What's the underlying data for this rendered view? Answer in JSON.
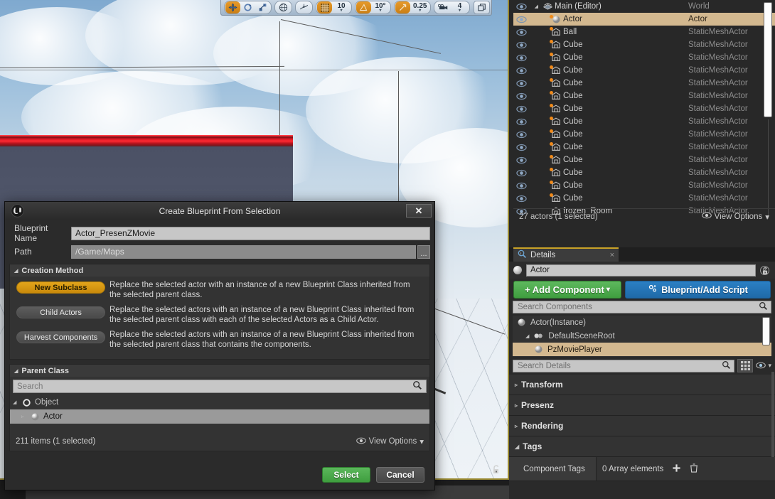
{
  "viewport": {
    "toolbar": {
      "groups": [
        {
          "name": "transform-modes",
          "buttons": [
            {
              "icon": "move-icon",
              "active": true
            },
            {
              "icon": "rotate-icon",
              "active": false
            },
            {
              "icon": "scale-icon",
              "active": false
            }
          ]
        },
        {
          "name": "coordinate-system",
          "buttons": [
            {
              "icon": "globe-icon",
              "active": false
            }
          ]
        },
        {
          "name": "surface-snap",
          "buttons": [
            {
              "icon": "surface-snap-icon",
              "active": false
            }
          ]
        },
        {
          "name": "grid-snap",
          "buttons": [
            {
              "icon": "grid-icon",
              "active": true
            }
          ],
          "value": "10"
        },
        {
          "name": "rotation-snap",
          "buttons": [
            {
              "icon": "angle-icon",
              "active": true
            }
          ],
          "value": "10°"
        },
        {
          "name": "scale-snap",
          "buttons": [
            {
              "icon": "scale-snap-icon",
              "active": true
            }
          ],
          "value": "0.25"
        },
        {
          "name": "camera-speed",
          "buttons": [
            {
              "icon": "camera-icon",
              "active": false
            }
          ],
          "value": "4"
        }
      ],
      "maximize_icon": "maximize-icon"
    },
    "lock_icon": "unlock-icon"
  },
  "outliner": {
    "rows": [
      {
        "name": "Main (Editor)",
        "type": "World",
        "icon": "level-icon",
        "dot": false,
        "selected": false,
        "depth": 0,
        "expander": true
      },
      {
        "name": "Actor",
        "type": "Actor",
        "icon": "sphere-icon",
        "dot": true,
        "selected": true,
        "depth": 1,
        "expander": false
      },
      {
        "name": "Ball",
        "type": "StaticMeshActor",
        "icon": "mesh-icon",
        "dot": true,
        "selected": false,
        "depth": 1,
        "expander": false
      },
      {
        "name": "Cube",
        "type": "StaticMeshActor",
        "icon": "mesh-icon",
        "dot": true,
        "selected": false,
        "depth": 1,
        "expander": false
      },
      {
        "name": "Cube",
        "type": "StaticMeshActor",
        "icon": "mesh-icon",
        "dot": true,
        "selected": false,
        "depth": 1,
        "expander": false
      },
      {
        "name": "Cube",
        "type": "StaticMeshActor",
        "icon": "mesh-icon",
        "dot": true,
        "selected": false,
        "depth": 1,
        "expander": false
      },
      {
        "name": "Cube",
        "type": "StaticMeshActor",
        "icon": "mesh-icon",
        "dot": true,
        "selected": false,
        "depth": 1,
        "expander": false
      },
      {
        "name": "Cube",
        "type": "StaticMeshActor",
        "icon": "mesh-icon",
        "dot": true,
        "selected": false,
        "depth": 1,
        "expander": false
      },
      {
        "name": "Cube",
        "type": "StaticMeshActor",
        "icon": "mesh-icon",
        "dot": true,
        "selected": false,
        "depth": 1,
        "expander": false
      },
      {
        "name": "Cube",
        "type": "StaticMeshActor",
        "icon": "mesh-icon",
        "dot": true,
        "selected": false,
        "depth": 1,
        "expander": false
      },
      {
        "name": "Cube",
        "type": "StaticMeshActor",
        "icon": "mesh-icon",
        "dot": true,
        "selected": false,
        "depth": 1,
        "expander": false
      },
      {
        "name": "Cube",
        "type": "StaticMeshActor",
        "icon": "mesh-icon",
        "dot": true,
        "selected": false,
        "depth": 1,
        "expander": false
      },
      {
        "name": "Cube",
        "type": "StaticMeshActor",
        "icon": "mesh-icon",
        "dot": true,
        "selected": false,
        "depth": 1,
        "expander": false
      },
      {
        "name": "Cube",
        "type": "StaticMeshActor",
        "icon": "mesh-icon",
        "dot": true,
        "selected": false,
        "depth": 1,
        "expander": false
      },
      {
        "name": "Cube",
        "type": "StaticMeshActor",
        "icon": "mesh-icon",
        "dot": true,
        "selected": false,
        "depth": 1,
        "expander": false
      },
      {
        "name": "Cube",
        "type": "StaticMeshActor",
        "icon": "mesh-icon",
        "dot": true,
        "selected": false,
        "depth": 1,
        "expander": false
      },
      {
        "name": "frozen_Room",
        "type": "StaticMeshActor",
        "icon": "mesh-icon",
        "dot": false,
        "selected": false,
        "depth": 1,
        "expander": false
      }
    ],
    "footer": {
      "count": "27 actors (1 selected)",
      "view_options": "View Options",
      "eye_icon": "eye-icon",
      "caret": "▾"
    }
  },
  "details": {
    "tab": {
      "label": "Details",
      "icon": "details-icon",
      "close": "×"
    },
    "name_value": "Actor",
    "help_icon": "help-icon",
    "lock_icon": "unlock-icon",
    "add_component": {
      "label": "Add Component",
      "plus": "+",
      "caret": "▾",
      "color": "#4aa34a"
    },
    "blueprint_script": {
      "label": "Blueprint/Add Script",
      "icon": "gears-icon",
      "color": "#2775b8"
    },
    "search_components_placeholder": "Search Components",
    "components": [
      {
        "name": "Actor(Instance)",
        "icon": "sphere-icon",
        "selected": false,
        "depth": 0,
        "expander": false
      },
      {
        "name": "DefaultSceneRoot",
        "icon": "scene-root-icon",
        "selected": false,
        "depth": 1,
        "expander": true
      },
      {
        "name": "PzMoviePlayer",
        "icon": "sphere-icon",
        "selected": true,
        "depth": 2,
        "expander": false
      }
    ],
    "search_details_placeholder": "Search Details",
    "toolbar_icons": {
      "grid": "grid-view-icon",
      "eye": "eye-icon",
      "caret": "▾"
    },
    "categories": [
      {
        "label": "Transform",
        "expanded": false
      },
      {
        "label": "Presenz",
        "expanded": false
      },
      {
        "label": "Rendering",
        "expanded": false
      },
      {
        "label": "Tags",
        "expanded": true
      }
    ],
    "tag_property": {
      "label": "Component Tags",
      "value": "0 Array elements",
      "add_icon": "plus-icon",
      "delete_icon": "trash-icon"
    }
  },
  "dialog": {
    "title": "Create Blueprint From Selection",
    "logo": "unreal-logo",
    "close": "✕",
    "fields": {
      "blueprint_name_label": "Blueprint Name",
      "blueprint_name_value": "Actor_PresenZMovie",
      "path_label": "Path",
      "path_value": "/Game/Maps",
      "browse_label": "..."
    },
    "creation_method": {
      "title": "Creation Method",
      "options": [
        {
          "label": "New Subclass",
          "active": true,
          "description": "Replace the selected actor with an instance of a new Blueprint Class inherited from the selected parent class."
        },
        {
          "label": "Child Actors",
          "active": false,
          "description": "Replace the selected actors with an instance of a new Blueprint Class inherited from the selected parent class with each of the selected Actors as a Child Actor."
        },
        {
          "label": "Harvest Components",
          "active": false,
          "description": "Replace the selected actors with an instance of a new Blueprint Class inherited from the selected parent class that contains the components."
        }
      ]
    },
    "parent_class": {
      "title": "Parent Class",
      "search_placeholder": "Search",
      "tree": [
        {
          "label": "Object",
          "depth": 0,
          "selected": false,
          "expander": "◢",
          "icon": "ring-icon"
        },
        {
          "label": "Actor",
          "depth": 1,
          "selected": true,
          "expander": "▹",
          "icon": "sphere-icon"
        }
      ],
      "footer": {
        "count": "211 items (1 selected)",
        "view_options": "View Options",
        "eye_icon": "eye-icon",
        "caret": "▾"
      }
    },
    "buttons": {
      "select": "Select",
      "cancel": "Cancel"
    }
  },
  "colors": {
    "accent_orange": "#e3a51b",
    "selection_tan": "#d3b88f",
    "green": "#4aa34a",
    "blue": "#2775b8",
    "panel_bg": "#2b2b2b"
  }
}
